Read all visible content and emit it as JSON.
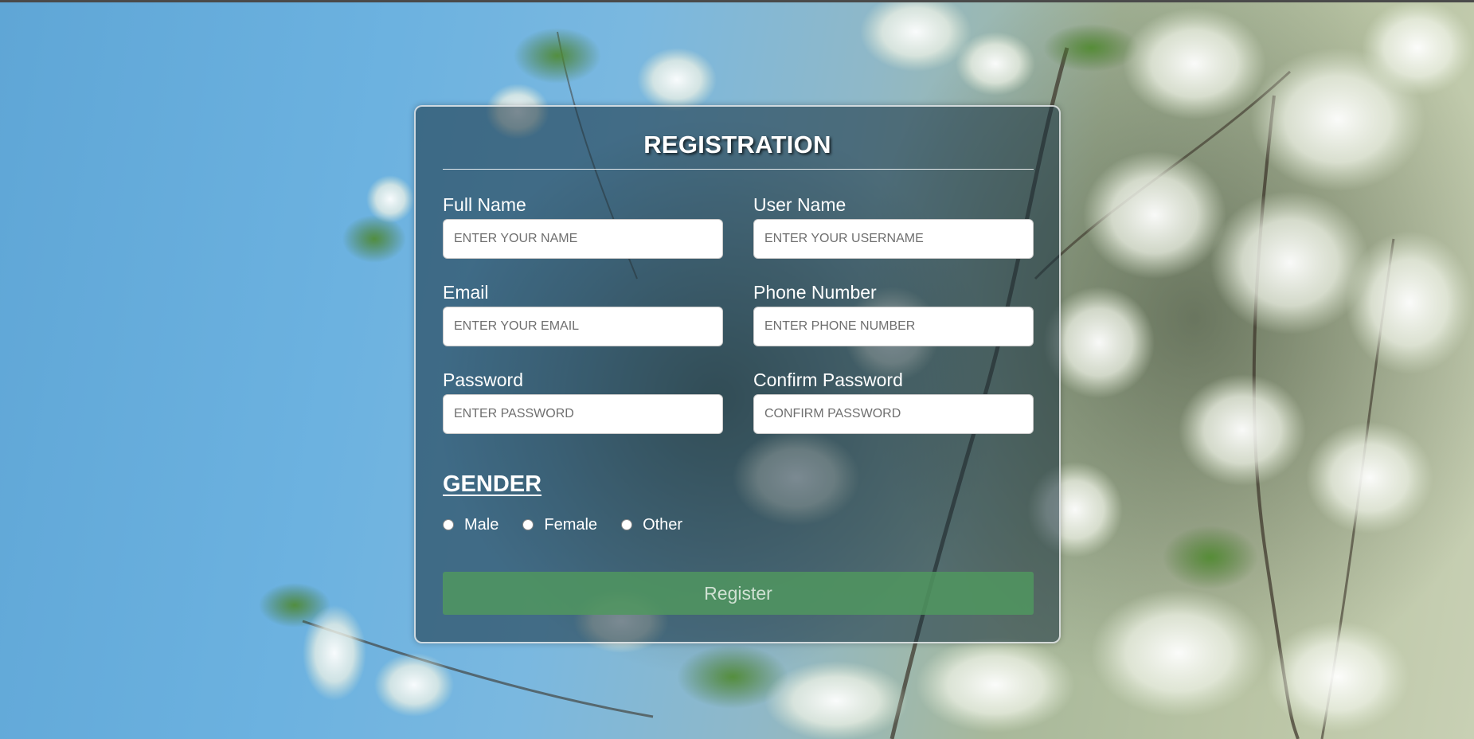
{
  "form": {
    "title": "REGISTRATION",
    "fields": [
      {
        "label": "Full Name",
        "placeholder": "ENTER YOUR NAME",
        "value": ""
      },
      {
        "label": "User Name",
        "placeholder": "ENTER YOUR USERNAME",
        "value": ""
      },
      {
        "label": "Email",
        "placeholder": "ENTER YOUR EMAIL",
        "value": ""
      },
      {
        "label": "Phone Number",
        "placeholder": "ENTER PHONE NUMBER",
        "value": ""
      },
      {
        "label": "Password",
        "placeholder": "ENTER PASSWORD",
        "value": ""
      },
      {
        "label": "Confirm Password",
        "placeholder": "CONFIRM PASSWORD",
        "value": ""
      }
    ],
    "gender": {
      "heading": "GENDER",
      "options": [
        "Male",
        "Female",
        "Other"
      ],
      "selected": null
    },
    "submit_label": "Register"
  },
  "colors": {
    "card_background": "#142d3c",
    "button": "#50965f",
    "text": "#ffffff"
  }
}
